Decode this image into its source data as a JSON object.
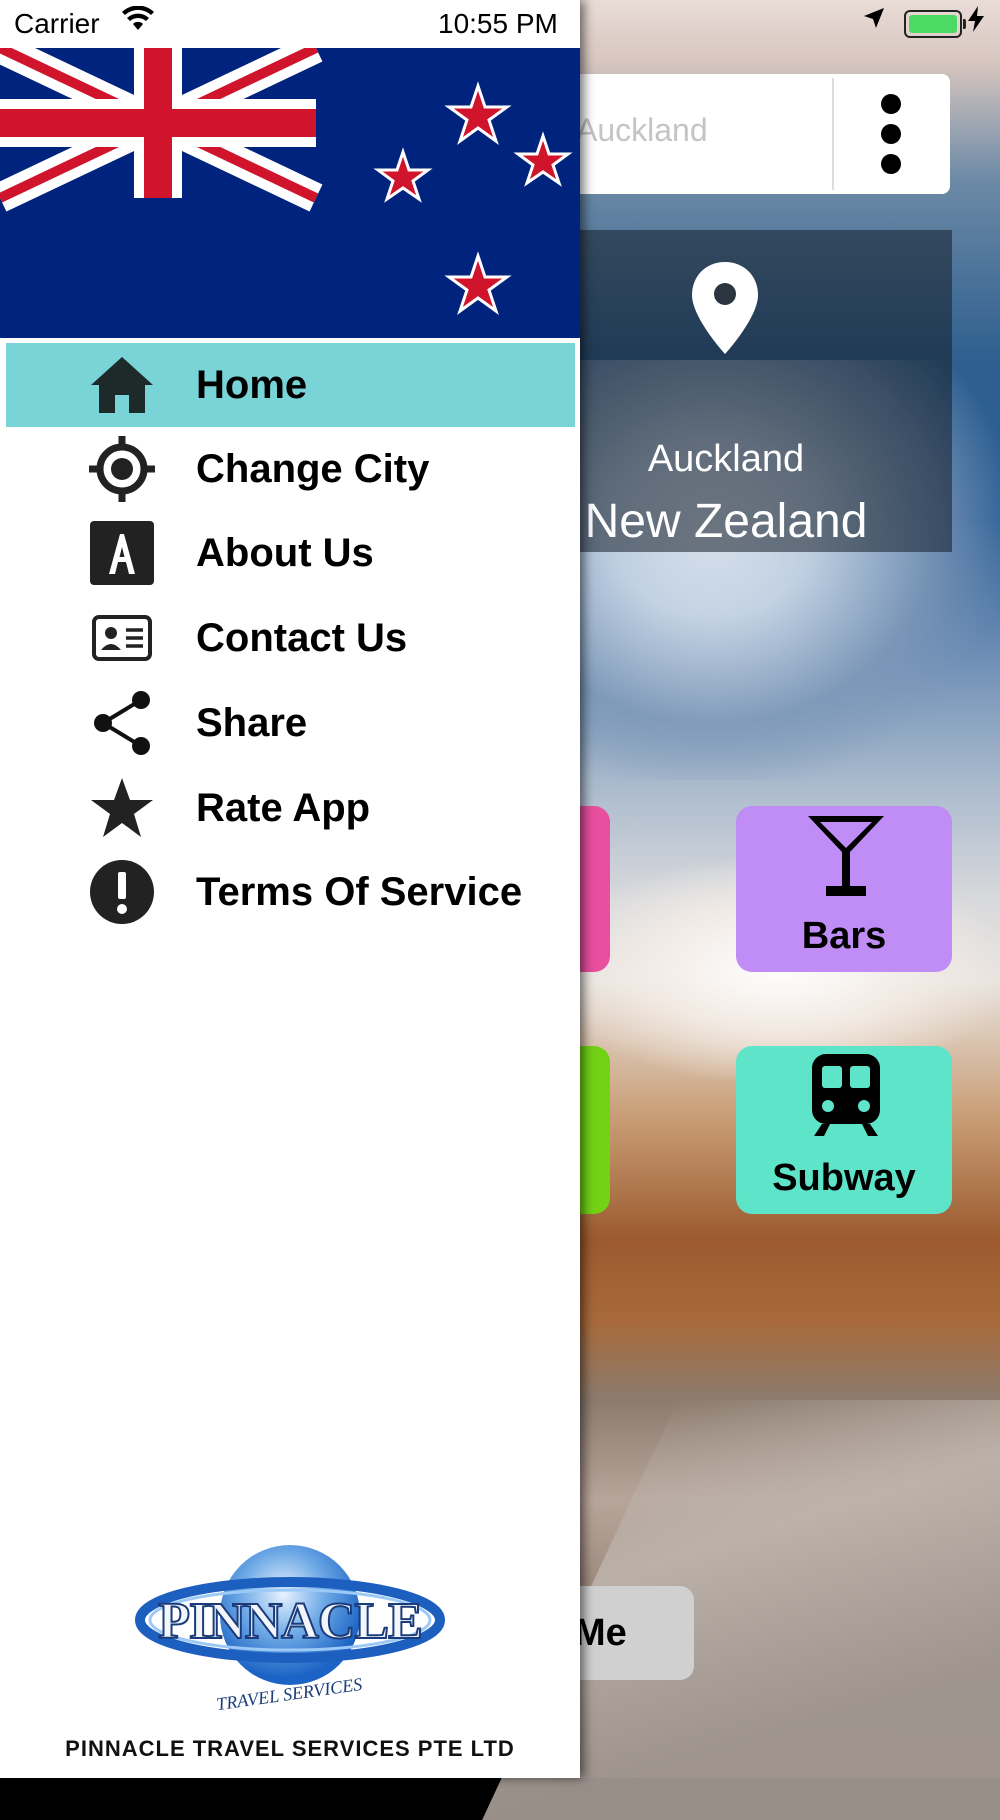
{
  "status_bar": {
    "carrier": "Carrier",
    "time": "10:55 PM"
  },
  "search": {
    "value": "Auckland"
  },
  "location": {
    "city": "Auckland",
    "country": "New Zealand"
  },
  "tiles": {
    "bars": "Bars",
    "subway": "Subway"
  },
  "me_button": {
    "label": "Me"
  },
  "drawer": {
    "menu": [
      {
        "label": "Home",
        "icon": "home-icon",
        "active": true
      },
      {
        "label": "Change City",
        "icon": "crosshair-icon",
        "active": false
      },
      {
        "label": "About Us",
        "icon": "about-icon",
        "active": false
      },
      {
        "label": "Contact Us",
        "icon": "contact-card-icon",
        "active": false
      },
      {
        "label": "Share",
        "icon": "share-icon",
        "active": false
      },
      {
        "label": "Rate App",
        "icon": "star-icon",
        "active": false
      },
      {
        "label": "Terms Of Service",
        "icon": "alert-icon",
        "active": false
      }
    ],
    "logo_text": "PINNACLE",
    "logo_subtext": "TRAVEL SERVICES",
    "company": "PINNACLE TRAVEL SERVICES PTE LTD"
  },
  "colors": {
    "active_item": "#79d4d8",
    "bars_tile": "#c08cf5",
    "subway_tile": "#5ee5c9",
    "flag_blue": "#00247d",
    "flag_red": "#cf142b"
  }
}
